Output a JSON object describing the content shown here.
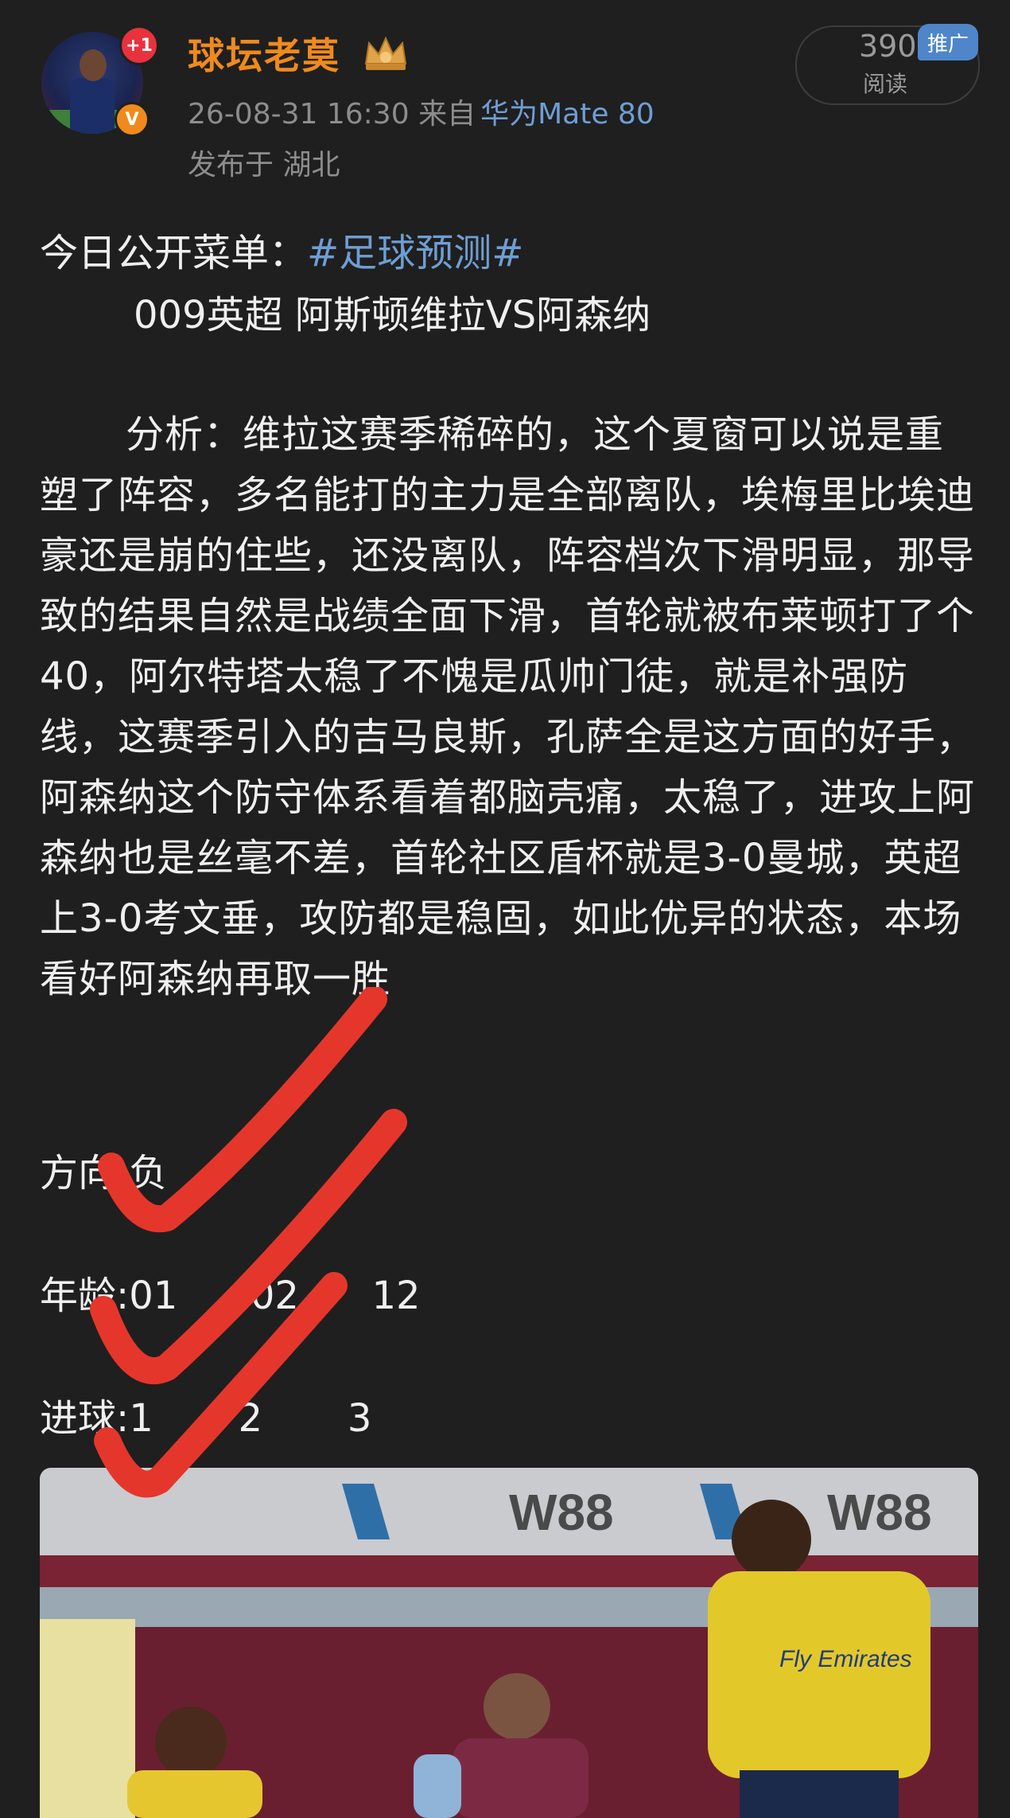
{
  "post": {
    "username": "球坛老莫",
    "plus_badge": "+1",
    "verified_badge": "V",
    "timestamp": "26-08-31 16:30",
    "source_prefix": "来自",
    "device": "华为Mate 80",
    "location": "发布于 湖北",
    "read_count": "390",
    "read_label": "阅读",
    "ad_badge": "推广"
  },
  "content": {
    "menu_label": "今日公开菜单：",
    "hashtag": "#足球预测#",
    "match_line": "009英超 阿斯顿维拉VS阿森纳",
    "analysis": "分析：维拉这赛季稀碎的，这个夏窗可以说是重塑了阵容，多名能打的主力是全部离队，埃梅里比埃迪豪还是崩的住些，还没离队，阵容档次下滑明显，那导致的结果自然是战绩全面下滑，首轮就被布莱顿打了个40，阿尔特塔太稳了不愧是瓜帅门徒，就是补强防线，这赛季引入的吉马良斯，孔萨全是这方面的好手，阿森纳这个防守体系看着都脑壳痛，太稳了，进攻上阿森纳也是丝毫不差，首轮社区盾杯就是3-0曼城，英超上3-0考文垂，攻防都是稳固，如此优异的状态，本场看好阿森纳再取一胜",
    "direction": "方向:负",
    "age_label": "年龄:",
    "age_values": [
      "01",
      "02",
      "12"
    ],
    "goals_label": "进球:",
    "goals_values": [
      "1",
      "2",
      "3"
    ]
  },
  "photo": {
    "banner_text": [
      "W88",
      "W88"
    ],
    "shirt_sponsor": "Fly Emirates"
  },
  "colors": {
    "background": "#1f1f1f",
    "username": "#f08a1c",
    "link": "#6f9ed4",
    "check_marks": "#e5362c"
  }
}
